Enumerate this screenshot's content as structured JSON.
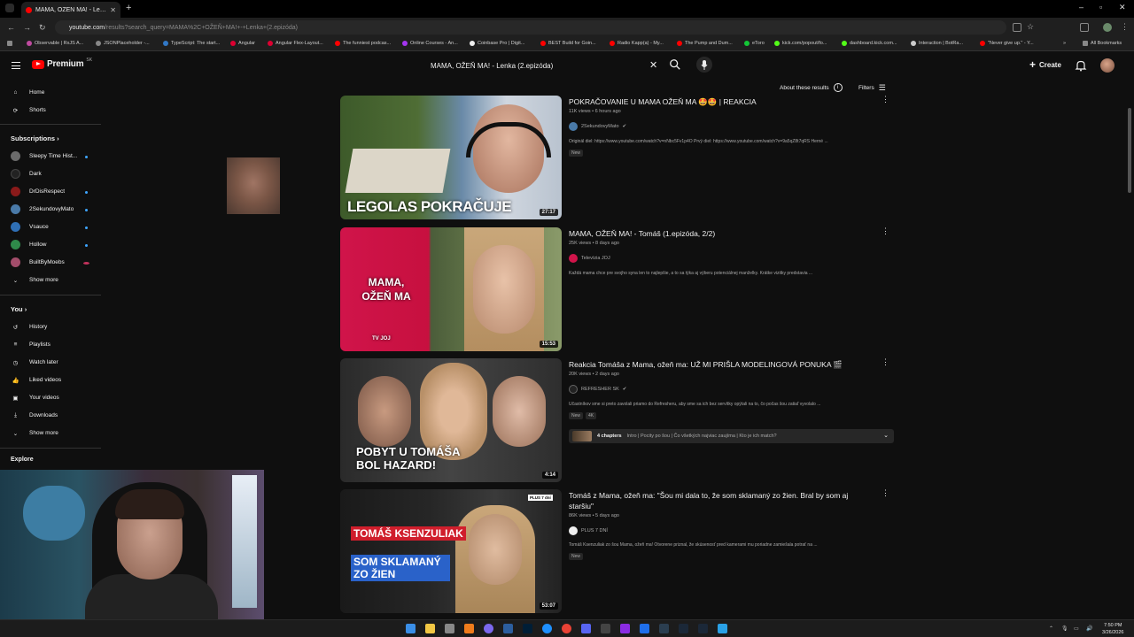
{
  "browser": {
    "tab_title": "MAMA, OŽEŇ MA! - Lenka (2.e...",
    "url_host": "youtube.com",
    "url_rest": "/results?search_query=MAMA%2C+OŽEŇ+MA!+-+Lenka+(2.epizóda)",
    "bookmarks": [
      "Observable | RxJS A...",
      "JSONPlaceholder -...",
      "TypeScript: The start...",
      "Angular",
      "Angular Flex-Layout...",
      "The funniest podcas...",
      "Online Courses - An...",
      "Coinbase Pro | Digit...",
      "BEST Build for Goin...",
      "Radio Kapp(a) - My...",
      "The Pump and Dum...",
      "eToro",
      "kick.com/popout/fo...",
      "dashboard.kick.com...",
      "Interaction | BotRa...",
      "\"Never give up.\" - Y..."
    ],
    "all_bookmarks": "All Bookmarks"
  },
  "header": {
    "logo": "Premium",
    "logo_region": "SK",
    "search_value": "MAMA, OŽEŇ MA! - Lenka (2.epizóda)",
    "create_label": "Create",
    "about_results": "About these results",
    "filters": "Filters"
  },
  "sidebar": {
    "home": "Home",
    "shorts": "Shorts",
    "subscriptions": "Subscriptions",
    "subs": [
      {
        "name": "Sleepy Time Hist...",
        "color": "#6b6b6b"
      },
      {
        "name": "Dark",
        "color": "#222222"
      },
      {
        "name": "DrDisRespect",
        "color": "#8a1a1a"
      },
      {
        "name": "2SekundovyMato",
        "color": "#4a7aa8"
      },
      {
        "name": "Vsauce",
        "color": "#2f6fb5"
      },
      {
        "name": "Hollow",
        "color": "#2f8a4a"
      },
      {
        "name": "BuiltByMoebs",
        "color": "#a34d6b"
      }
    ],
    "show_more": "Show more",
    "you": "You",
    "you_items": [
      "History",
      "Playlists",
      "Watch later",
      "Liked videos",
      "Your videos",
      "Downloads"
    ],
    "show_more2": "Show more",
    "explore": "Explore"
  },
  "results": [
    {
      "title": "POKRAČOVANIE U MAMA OŽEŇ MA 🤩🤩 | REAKCIA",
      "meta": "11K views • 6 hours ago",
      "channel": "2SekundovyMato",
      "desc": "Originál diel: https://www.youtube.com/watch?v=nNbc5Fv1p4O Prvý diel: https://www.youtube.com/watch?v=9a5qZ8t7qRS Herné ...",
      "badges": [
        "New"
      ],
      "duration": "27:17",
      "thumb_text": "LEGOLAS POKRAČUJE"
    },
    {
      "title": "MAMA, OŽEŇ MA! - Tomáš (1.epizóda, 2/2)",
      "meta": "25K views • 8 days ago",
      "channel": "Televízia JOJ",
      "desc": "Každá mama chce pre svojho syna len to najlepšie, a to sa týka aj výberu potenciálnej manželky. Krátke vizitky predstavia ...",
      "badges": [],
      "duration": "15:53",
      "thumb_text": "MAMA, OŽEŇ MA",
      "thumb_logo": "TV JOJ"
    },
    {
      "title": "Reakcia Tomáša z Mama, ožeň ma: UŽ MI PRIŠLA MODELINGOVÁ PONUKA 🎬",
      "meta": "20K views • 2 days ago",
      "channel": "REFRESHER SK",
      "desc": "Účastníkov sme si preto zavolali priamo do Refresheru, aby sme sa ich bez servítky opýtali na to, čo počas šou zatiaľ vyvolalo ...",
      "badges": [
        "New",
        "4K"
      ],
      "duration": "4:14",
      "thumb_text": "POBYT U TOMÁŠA BOL HAZARD!",
      "chapters_count": "4 chapters",
      "chapters_list": "Intro | Pocity po šou | Čo všetkých najviac zaujíma | Kto je ich match?"
    },
    {
      "title": "Tomáš z Mama, ožeň ma: \"Šou mi dala to, že som sklamaný zo žien. Bral by som aj staršiu\"",
      "meta": "86K views • 5 days ago",
      "channel": "PLUS 7 DNÍ",
      "desc": "Tomáš Ksenzuliak zo šou Mama, ožeň ma! Otvorene priznal, že skúsenosť pred kamerami mu poriadne zamiešala potrať na ...",
      "badges": [
        "New"
      ],
      "duration": "53:07",
      "thumb_text1": "TOMÁŠ KSENZULIAK",
      "thumb_text2": "SOM SKLAMANÝ ZO ŽIEN",
      "thumb_tag": "PLUS 7 dní"
    }
  ],
  "taskbar": {
    "time": "7:50 PM",
    "date": "3/26/2026"
  },
  "colors": {
    "brand": "#ff0000",
    "bg": "#0f0f0f",
    "accent": "#3ea6ff"
  }
}
